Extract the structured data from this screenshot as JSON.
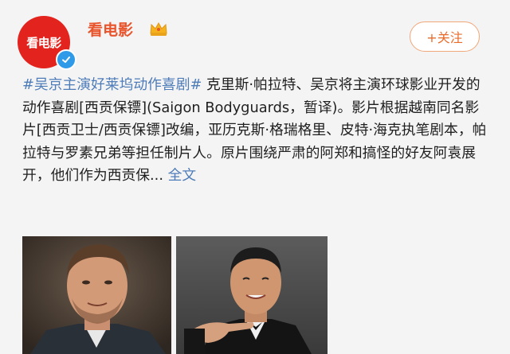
{
  "account": {
    "avatar_text": "看电影",
    "name": "看电影",
    "post_time": "",
    "icons": {
      "badge": "crown-icon",
      "verified": "verified-icon",
      "follow": "plus-icon"
    }
  },
  "follow_button": {
    "label": "+关注"
  },
  "post": {
    "hashtag": "#吴京主演好莱坞动作喜剧#",
    "body": " 克里斯·帕拉特、吴京将主演环球影业开发的动作喜剧[西贡保镖](Saigon Bodyguards，暂译)。影片根据越南同名影片[西贡卫士/西贡保镖]改编，亚历克斯·格瑞格里、皮特·海克执笔剧本，帕拉特与罗素兄弟等担任制片人。原片围绕严肃的阿郑和搞怪的好友阿袁展开，他们作为西贡保...",
    "expand_label": " 全文"
  },
  "images": [
    {
      "description_icon": "photo-man-suit"
    },
    {
      "description_icon": "photo-man-tuxedo"
    }
  ],
  "colors": {
    "brand_red": "#e3231d",
    "name_orange": "#e8542b",
    "link_blue": "#4e7cb8",
    "follow_orange": "#e86c2c",
    "verified_blue": "#2f9ae8"
  }
}
